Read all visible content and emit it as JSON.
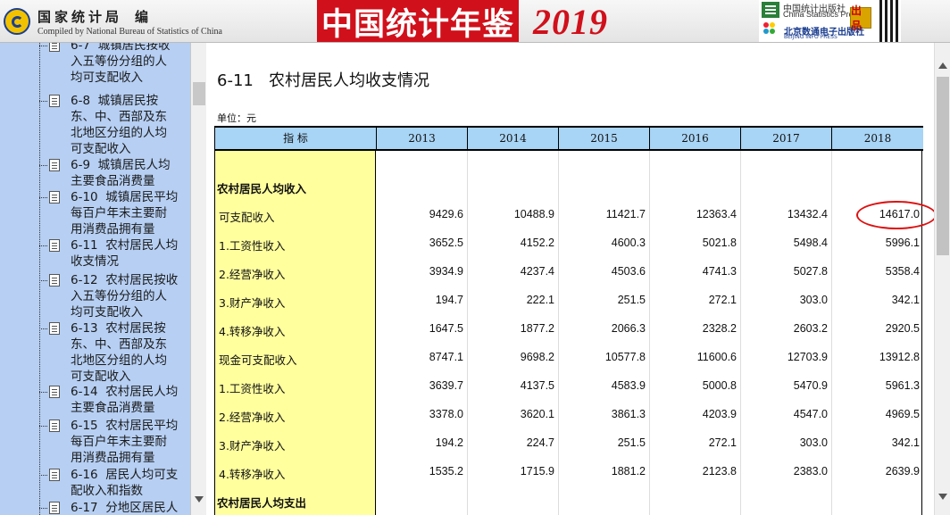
{
  "header": {
    "org_cn": "国家统计局",
    "edit_cn": "编",
    "org_en": "Compiled by National Bureau of Statistics of China",
    "book_title": "中国统计年鉴",
    "year": "2019",
    "publisher_cn": "中国统计出版社",
    "publisher_en": "China Statistics Press",
    "stamp": "出品",
    "digital_publisher_cn": "北京数通电子出版社",
    "digital_publisher_en": "BEIJING INFO PRESS"
  },
  "sidebar": {
    "items": [
      {
        "text": "6-7  城镇居民按收\n入五等份分组的人\n均可支配收入"
      },
      {
        "text": "6-8  城镇居民按\n东、中、西部及东\n北地区分组的人均\n可支配收入"
      },
      {
        "text": "6-9  城镇居民人均\n主要食品消费量"
      },
      {
        "text": "6-10  城镇居民平均\n每百户年末主要耐\n用消费品拥有量"
      },
      {
        "text": "6-11  农村居民人均\n收支情况"
      },
      {
        "text": "6-12  农村居民按收\n入五等份分组的人\n均可支配收入"
      },
      {
        "text": "6-13  农村居民按\n东、中、西部及东\n北地区分组的人均\n可支配收入"
      },
      {
        "text": "6-14  农村居民人均\n主要食品消费量"
      },
      {
        "text": "6-15  农村居民平均\n每百户年末主要耐\n用消费品拥有量"
      },
      {
        "text": "6-16  居民人均可支\n配收入和指数"
      },
      {
        "text": "6-17  分地区居民人"
      }
    ]
  },
  "main": {
    "title": "6-11   农村居民人均收支情况",
    "unit": "单位：元",
    "header_label": "指        标",
    "years": [
      "2013",
      "2014",
      "2015",
      "2016",
      "2017",
      "2018"
    ],
    "rows": [
      {
        "label": "农村居民人均收入",
        "section": true,
        "values": [
          "",
          "",
          "",
          "",
          "",
          ""
        ]
      },
      {
        "label": "可支配收入",
        "section": false,
        "values": [
          "9429.6",
          "10488.9",
          "11421.7",
          "12363.4",
          "13432.4",
          "14617.0"
        ]
      },
      {
        "label": "1.工资性收入",
        "section": false,
        "values": [
          "3652.5",
          "4152.2",
          "4600.3",
          "5021.8",
          "5498.4",
          "5996.1"
        ]
      },
      {
        "label": "2.经营净收入",
        "section": false,
        "values": [
          "3934.9",
          "4237.4",
          "4503.6",
          "4741.3",
          "5027.8",
          "5358.4"
        ]
      },
      {
        "label": "3.财产净收入",
        "section": false,
        "values": [
          "194.7",
          "222.1",
          "251.5",
          "272.1",
          "303.0",
          "342.1"
        ]
      },
      {
        "label": "4.转移净收入",
        "section": false,
        "values": [
          "1647.5",
          "1877.2",
          "2066.3",
          "2328.2",
          "2603.2",
          "2920.5"
        ]
      },
      {
        "label": "现金可支配收入",
        "section": false,
        "values": [
          "8747.1",
          "9698.2",
          "10577.8",
          "11600.6",
          "12703.9",
          "13912.8"
        ]
      },
      {
        "label": "1.工资性收入",
        "section": false,
        "values": [
          "3639.7",
          "4137.5",
          "4583.9",
          "5000.8",
          "5470.9",
          "5961.3"
        ]
      },
      {
        "label": "2.经营净收入",
        "section": false,
        "values": [
          "3378.0",
          "3620.1",
          "3861.3",
          "4203.9",
          "4547.0",
          "4969.5"
        ]
      },
      {
        "label": "3.财产净收入",
        "section": false,
        "values": [
          "194.2",
          "224.7",
          "251.5",
          "272.1",
          "303.0",
          "342.1"
        ]
      },
      {
        "label": "4.转移净收入",
        "section": false,
        "values": [
          "1535.2",
          "1715.9",
          "1881.2",
          "2123.8",
          "2383.0",
          "2639.9"
        ]
      },
      {
        "label": "农村居民人均支出",
        "section": true,
        "values": [
          "",
          "",
          "",
          "",
          "",
          ""
        ]
      }
    ]
  },
  "colors": {
    "sidebar_bg": "#b6cff3",
    "header_row_bg": "#a8d4f5",
    "indicator_col_bg": "#ffff9e",
    "highlight": "#d11111",
    "title_red": "#d0101b"
  }
}
